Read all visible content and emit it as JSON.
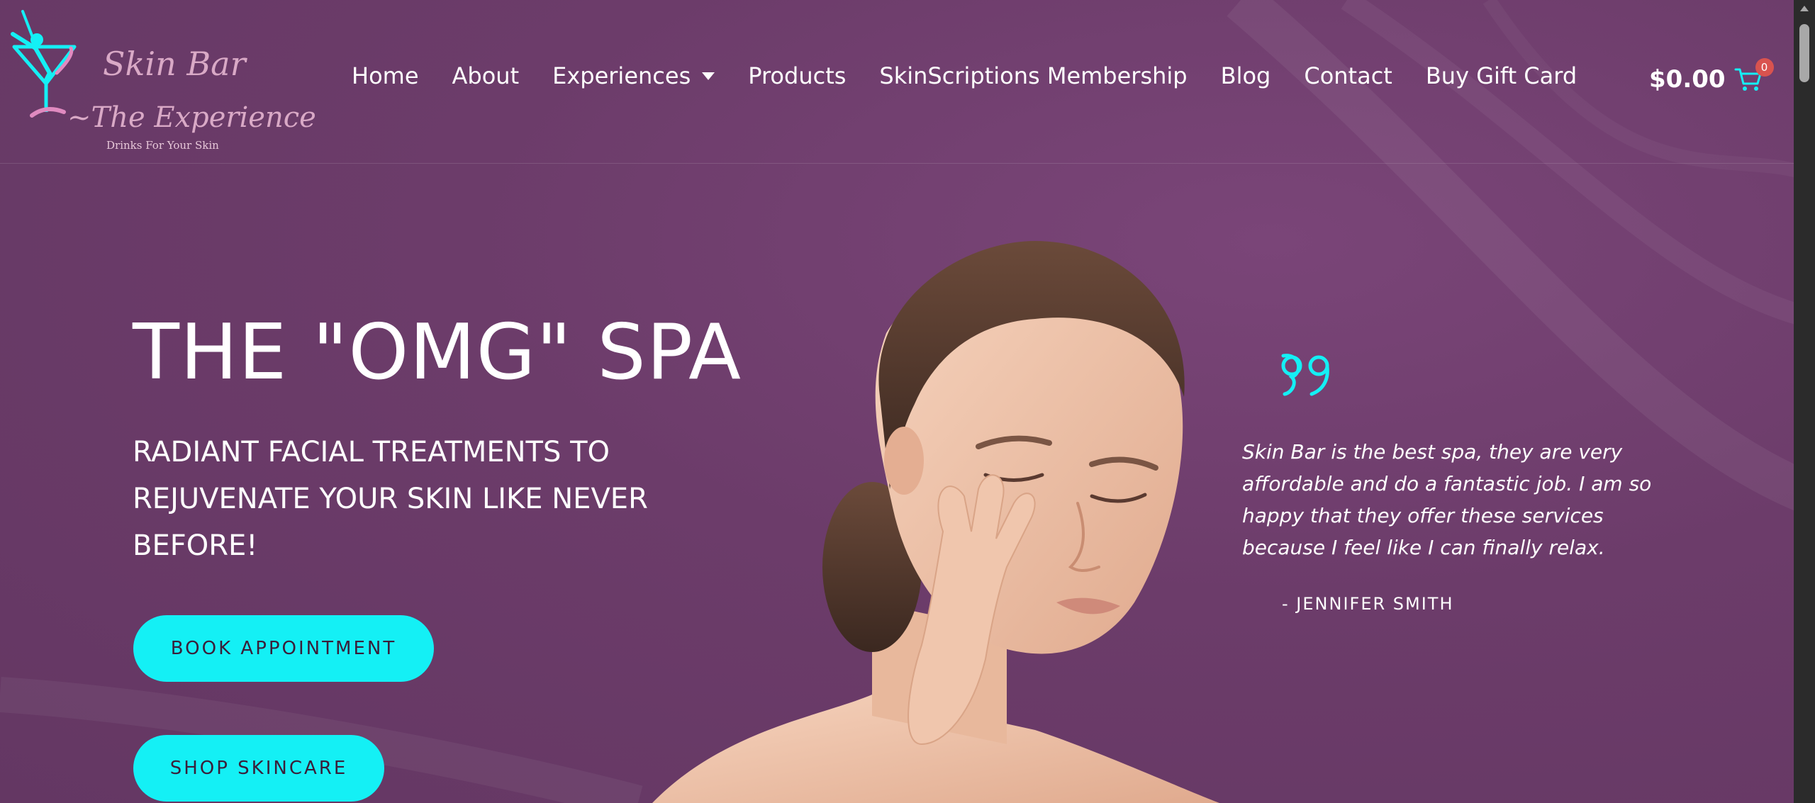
{
  "colors": {
    "background": "#6c3c6a",
    "accent": "#14f0f5",
    "text": "#ffffff",
    "logo_text": "#d9a9c6",
    "badge": "#d9534f"
  },
  "logo": {
    "line1": "Skin Bar",
    "line2": "~The Experience",
    "tagline": "Drinks For Your Skin",
    "icon": "martini-glass-dancer-icon"
  },
  "nav": {
    "items": [
      {
        "label": "Home"
      },
      {
        "label": "About"
      },
      {
        "label": "Experiences",
        "has_dropdown": true
      },
      {
        "label": "Products"
      },
      {
        "label": "SkinScriptions Membership"
      },
      {
        "label": "Blog"
      },
      {
        "label": "Contact"
      },
      {
        "label": "Buy Gift Card"
      }
    ]
  },
  "cart": {
    "total": "$0.00",
    "count": "0",
    "icon": "cart-icon"
  },
  "hero": {
    "title": "THE \"OMG\" SPA",
    "subtitle": "RADIANT FACIAL TREATMENTS TO REJUVENATE YOUR SKIN LIKE NEVER BEFORE!",
    "book_button": "BOOK APPOINTMENT",
    "shop_button": "SHOP SKINCARE"
  },
  "testimonial": {
    "quote_icon": "quote-icon",
    "text": "Skin Bar is the best spa, they are very affordable and do a fantastic job. I am so happy that they offer these services because I feel like I can finally relax.",
    "author": "- JENNIFER SMITH"
  }
}
